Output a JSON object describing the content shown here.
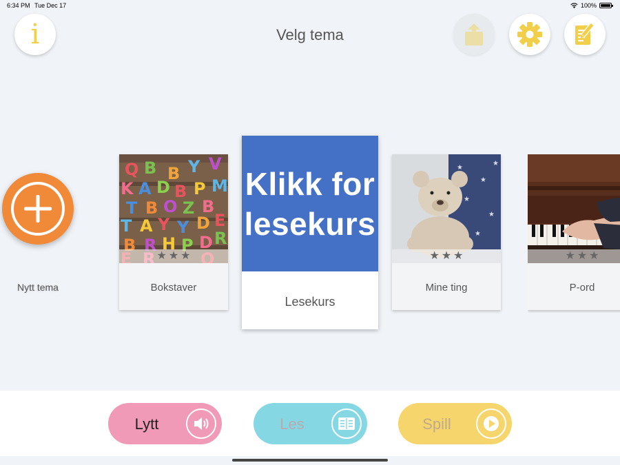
{
  "status": {
    "time": "6:34 PM",
    "date": "Tue Dec 17",
    "battery": "100%"
  },
  "header": {
    "title": "Velg tema"
  },
  "icons": {
    "info": "info-icon",
    "share": "share-icon",
    "settings": "gear-icon",
    "notes": "notepad-pencil-icon",
    "add": "plus-icon",
    "listen": "speaker-icon",
    "read": "book-icon",
    "play": "play-icon"
  },
  "add_theme": {
    "label": "Nytt tema"
  },
  "themes": [
    {
      "label": "Bokstaver",
      "stars": 3
    },
    {
      "label": "Lesekurs",
      "promo_line1": "Klikk for",
      "promo_line2": "lesekurs"
    },
    {
      "label": "Mine ting",
      "stars": 3
    },
    {
      "label": "P-ord",
      "stars": 3
    }
  ],
  "modes": [
    {
      "label": "Lytt",
      "color": "#f19ab8"
    },
    {
      "label": "Les",
      "color": "#86d7e4"
    },
    {
      "label": "Spill",
      "color": "#f5d56c"
    }
  ],
  "colors": {
    "accent_orange": "#f08a38",
    "accent_yellow": "#f2cf4a",
    "promo_blue": "#4471c5"
  }
}
